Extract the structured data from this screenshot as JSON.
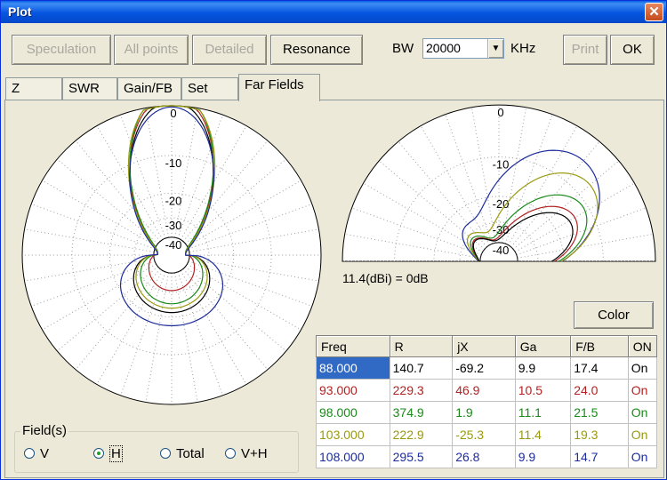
{
  "window": {
    "title": "Plot",
    "close_symbol": "✕"
  },
  "toolbar": {
    "buttons": [
      {
        "label": "Speculation",
        "enabled": false
      },
      {
        "label": "All points",
        "enabled": false
      },
      {
        "label": "Detailed",
        "enabled": false
      },
      {
        "label": "Resonance",
        "enabled": true
      }
    ],
    "bw_label": "BW",
    "bw_value": "20000",
    "bw_unit": "KHz",
    "print_label": "Print",
    "ok_label": "OK"
  },
  "tabs": [
    {
      "label": "Z",
      "active": false
    },
    {
      "label": "SWR",
      "active": false
    },
    {
      "label": "Gain/FB",
      "active": false
    },
    {
      "label": "Set",
      "active": false
    },
    {
      "label": "Far Fields",
      "active": true
    }
  ],
  "polar": {
    "ring_labels": [
      "0",
      "-10",
      "-20",
      "-30",
      "-40"
    ],
    "reference": "11.4(dBi) = 0dB"
  },
  "color_button": "Color",
  "table": {
    "headers": [
      "Freq",
      "R",
      "jX",
      "Ga",
      "F/B",
      "ON"
    ],
    "rows": [
      {
        "freq": "88.000",
        "r": "140.7",
        "jx": "-69.2",
        "ga": "9.9",
        "fb": "17.4",
        "on": "On",
        "color": "#000000",
        "selected": true
      },
      {
        "freq": "93.000",
        "r": "229.3",
        "jx": "46.9",
        "ga": "10.5",
        "fb": "24.0",
        "on": "On",
        "color": "#b22222",
        "selected": false
      },
      {
        "freq": "98.000",
        "r": "374.9",
        "jx": "1.9",
        "ga": "11.1",
        "fb": "21.5",
        "on": "On",
        "color": "#1a8a1a",
        "selected": false
      },
      {
        "freq": "103.000",
        "r": "222.9",
        "jx": "-25.3",
        "ga": "11.4",
        "fb": "19.3",
        "on": "On",
        "color": "#9a9a10",
        "selected": false
      },
      {
        "freq": "108.000",
        "r": "295.5",
        "jx": "26.8",
        "ga": "9.9",
        "fb": "14.7",
        "on": "On",
        "color": "#1c2c9c",
        "selected": false
      }
    ]
  },
  "fields": {
    "legend": "Field(s)",
    "options": [
      {
        "label": "V",
        "checked": false
      },
      {
        "label": "H",
        "checked": true
      },
      {
        "label": "Total",
        "checked": false
      },
      {
        "label": "V+H",
        "checked": false
      }
    ]
  },
  "patterns": {
    "azimuth_lobes": [
      {
        "fw": 0.93,
        "fwidth": 0.33,
        "back": 0.27,
        "bwidth": 0.55,
        "color": "#000000"
      },
      {
        "fw": 0.97,
        "fwidth": 0.31,
        "back": 0.12,
        "bwidth": 0.45,
        "color": "#b22222"
      },
      {
        "fw": 1.0,
        "fwidth": 0.29,
        "back": 0.21,
        "bwidth": 0.5,
        "color": "#1a8a1a"
      },
      {
        "fw": 0.99,
        "fwidth": 0.32,
        "back": 0.24,
        "bwidth": 0.55,
        "color": "#9a9a10"
      },
      {
        "fw": 0.89,
        "fwidth": 0.37,
        "back": 0.36,
        "bwidth": 0.65,
        "color": "#1c2c9c"
      }
    ]
  }
}
